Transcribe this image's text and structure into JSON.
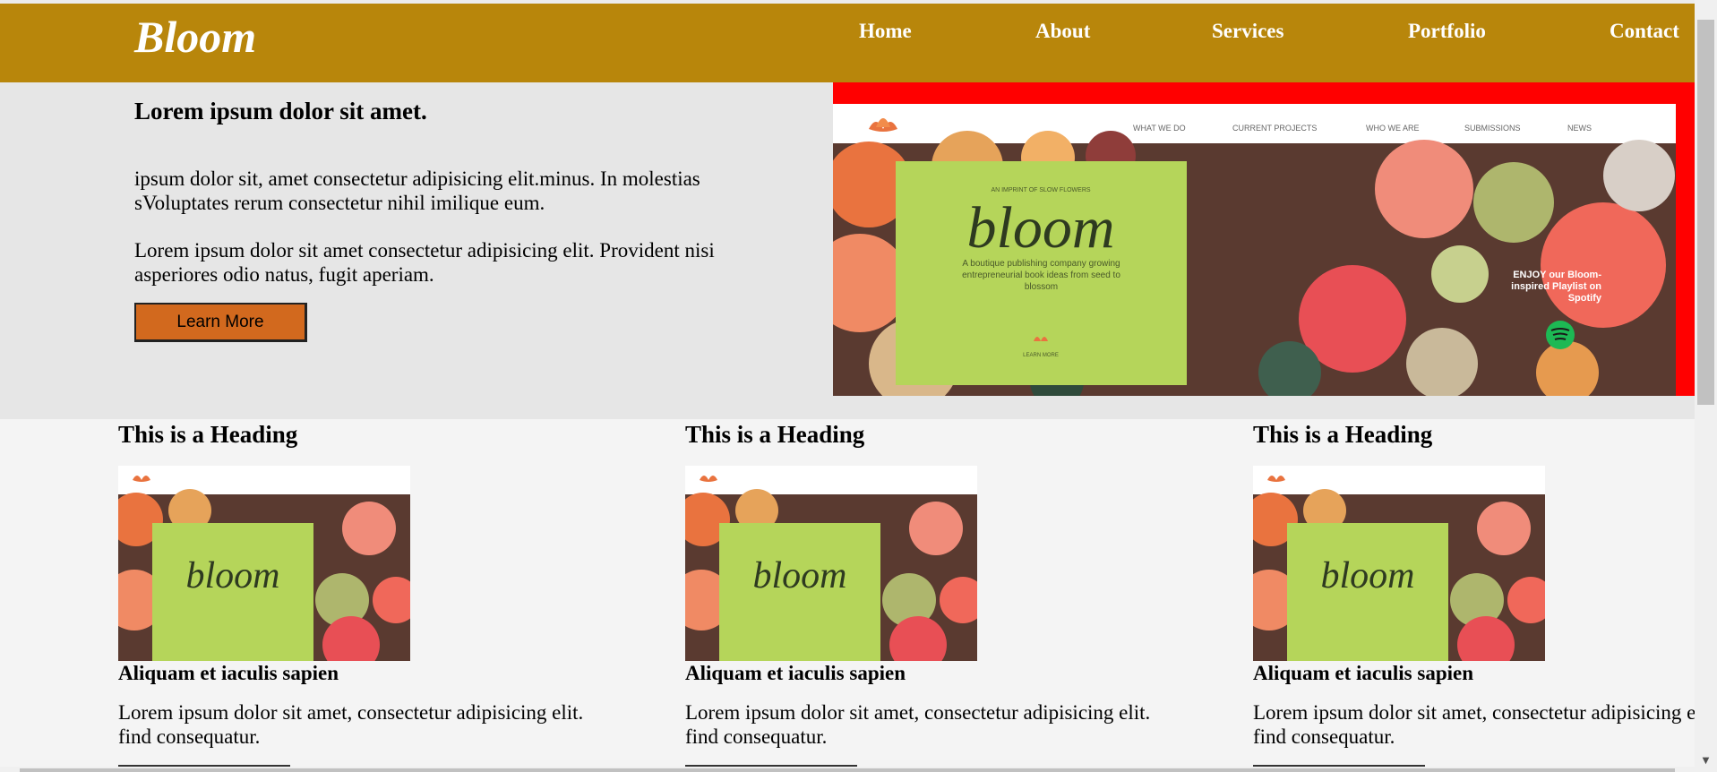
{
  "brand": {
    "logo": "Bloom",
    "accent": "#b8860b",
    "button_color": "#d2691e",
    "frame_color": "#ff0000"
  },
  "nav": {
    "items": [
      {
        "label": "Home"
      },
      {
        "label": "About"
      },
      {
        "label": "Services"
      },
      {
        "label": "Portfolio"
      },
      {
        "label": "Contact"
      }
    ]
  },
  "hero": {
    "heading": "Lorem ipsum dolor sit amet.",
    "paragraph1": "ipsum dolor sit, amet consectetur adipisicing elit.minus. In molestias sVoluptates rerum consectetur nihil imilique eum.",
    "paragraph2": "Lorem ipsum dolor sit amet consectetur adipisicing elit. Provident nisi asperiores odio natus, fugit aperiam.",
    "button_label": "Learn More",
    "image": {
      "site_nav": [
        "WHAT WE DO",
        "CURRENT PROJECTS",
        "WHO WE ARE",
        "SUBMISSIONS",
        "NEWS"
      ],
      "card_kicker": "AN IMPRINT OF SLOW FLOWERS",
      "card_title": "bloom",
      "card_text": "A boutique publishing company growing entrepreneurial book ideas from seed to blossom",
      "card_link": "LEARN MORE",
      "spotify_text": "ENJOY our Bloom-inspired Playlist on Spotify"
    }
  },
  "columns": [
    {
      "heading": "This is a Heading",
      "subheading": "Aliquam et iaculis sapien",
      "text": "Lorem ipsum dolor sit amet, consectetur adipisicing elit. find consequatur."
    },
    {
      "heading": "This is a Heading",
      "subheading": "Aliquam et iaculis sapien",
      "text": "Lorem ipsum dolor sit amet, consectetur adipisicing elit. find consequatur."
    },
    {
      "heading": "This is a Heading",
      "subheading": "Aliquam et iaculis sapien",
      "text": "Lorem ipsum dolor sit amet, consectetur adipisicing elit. find consequatur."
    }
  ],
  "scrollbar": {
    "up_icon": "triangle-up-icon",
    "down_icon": "triangle-down-icon"
  }
}
